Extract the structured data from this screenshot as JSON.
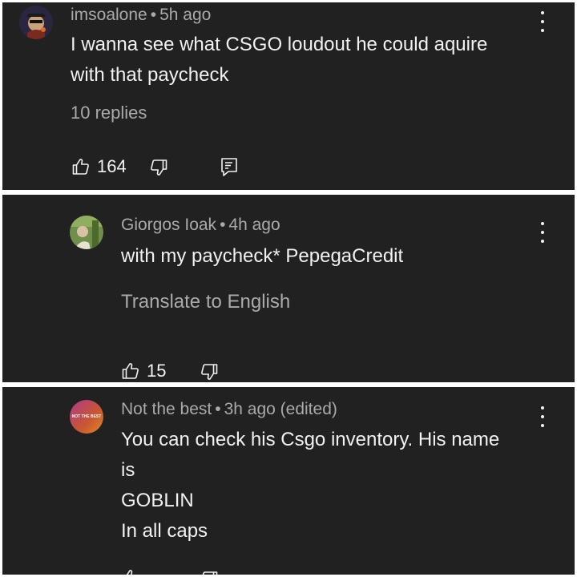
{
  "comments": [
    {
      "username": "imsoalone",
      "separator": "•",
      "time": "5h ago",
      "lines": [
        "I wanna see what CSGO loudout he could aquire",
        "with that paycheck"
      ],
      "replies_label": "10 replies",
      "likes": "164",
      "avatar_icon": "character-avatar"
    },
    {
      "username": "Giorgos Ioak",
      "separator": "•",
      "time": "4h ago",
      "lines": [
        "with my paycheck* PepegaCredit"
      ],
      "translate_label": "Translate to English",
      "likes": "15",
      "avatar_icon": "photo-avatar"
    },
    {
      "username": "Not the best",
      "separator": "•",
      "time": "3h ago (edited)",
      "lines": [
        "You can check his Csgo inventory. His name",
        "is",
        "GOBLIN",
        "In all caps"
      ],
      "avatar_text": "NOT THE BEST",
      "avatar_icon": "gradient-logo-avatar"
    }
  ],
  "colors": {
    "background": "#212121",
    "text_primary": "#f1f1f1",
    "text_secondary": "#aaaaaa",
    "divider": "#ffffff"
  },
  "icons": [
    "thumbs-up-icon",
    "thumbs-down-icon",
    "reply-icon",
    "more-vert-icon"
  ]
}
